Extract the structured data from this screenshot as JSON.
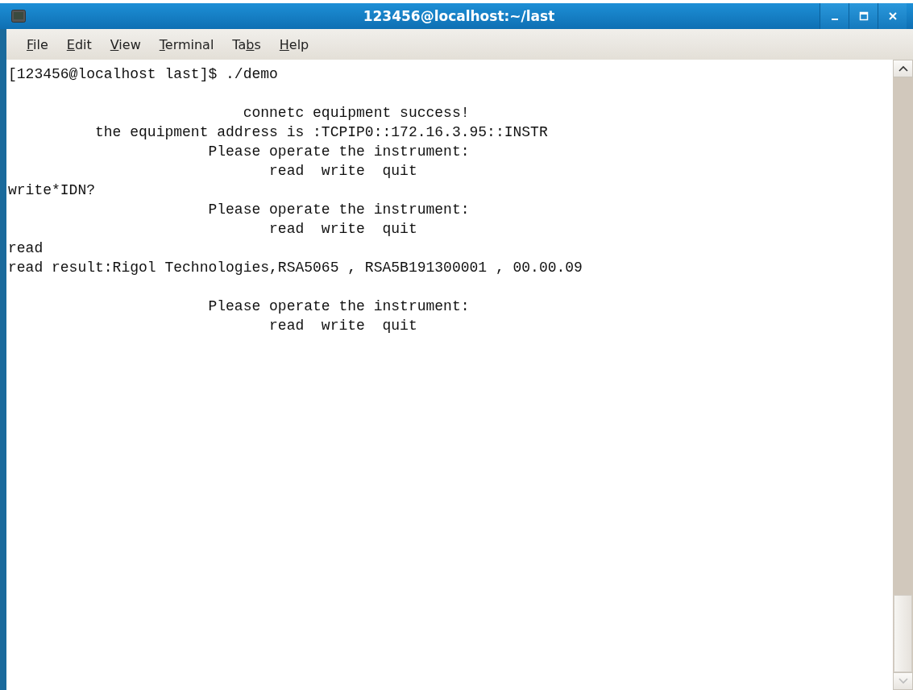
{
  "window": {
    "title": "123456@localhost:~/last"
  },
  "menu": [
    {
      "access_key": "F",
      "rest": "ile"
    },
    {
      "access_key": "E",
      "rest": "dit"
    },
    {
      "access_key": "V",
      "rest": "iew"
    },
    {
      "access_key": "T",
      "rest": "erminal"
    },
    {
      "before": "Ta",
      "access_key": "b",
      "rest": "s"
    },
    {
      "access_key": "H",
      "rest": "elp"
    }
  ],
  "terminal": {
    "paragraphs": [
      {
        "lines": [
          "[123456@localhost last]$ ./demo"
        ]
      },
      {
        "lines": [
          "                           connetc equipment success!",
          "          the equipment address is :TCPIP0::172.16.3.95::INSTR",
          "                       Please operate the instrument:",
          "                              read  write  quit",
          "write*IDN?",
          "                       Please operate the instrument:",
          "                              read  write  quit",
          "read",
          "read result:Rigol Technologies,RSA5065 , RSA5B191300001 , 00.00.09"
        ]
      },
      {
        "lines": [
          "                       Please operate the instrument:",
          "                              read  write  quit"
        ]
      }
    ]
  }
}
